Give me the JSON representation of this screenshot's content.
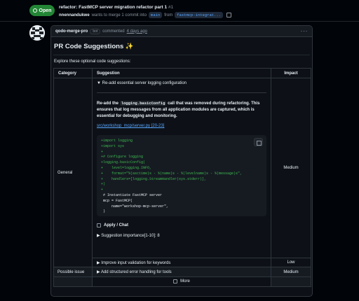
{
  "pr": {
    "status": "Open",
    "title": "refactor: FastMCP server migration refactor part 1",
    "number": "#1",
    "author": "nnennandukwe",
    "meta_middle": "wants to merge 1 commit into",
    "base_branch": "main",
    "from": "from",
    "head_branch": "fastmcp-integrat..."
  },
  "comment": {
    "author": "qodo-merge-pro",
    "bot_badge": "bot",
    "action": "commented",
    "time": "4 days ago",
    "menu": "···",
    "heading": "PR Code Suggestions ✨",
    "intro": "Explore these optional code suggestions:"
  },
  "table": {
    "headers": {
      "category": "Category",
      "suggestion": "Suggestion",
      "impact": "Impact"
    },
    "general": {
      "category": "General",
      "impact": "Medium",
      "summary": "▼ Re-add essential server logging configuration",
      "desc_pre": "Re-add the",
      "desc_code": "logging.basicConfig",
      "desc_post": "call that was removed during refactoring. This ensures that log messages from all application modules are captured, which is essential for debugging and monitoring.",
      "link": "src/workshop_mcp/server.py [20-23]",
      "code_lines": [
        {
          "text": "+import logging",
          "type": "add"
        },
        {
          "text": "+import sys",
          "type": "add"
        },
        {
          "text": "+",
          "type": "add"
        },
        {
          "text": "+# Configure logging",
          "type": "add"
        },
        {
          "text": "+logging.basicConfig(",
          "type": "add"
        },
        {
          "text": "+    level=logging.INFO,",
          "type": "add"
        },
        {
          "text": "+    format=\"%(asctime)s - %(name)s - %(levelname)s - %(message)s\",",
          "type": "add"
        },
        {
          "text": "+    handlers=[logging.StreamHandler(sys.stderr)],",
          "type": "add"
        },
        {
          "text": "+)",
          "type": "add"
        },
        {
          "text": "+",
          "type": "add"
        },
        {
          "text": " # Instantiate FastMCP server",
          "type": "ctx"
        },
        {
          "text": " mcp = FastMCP(",
          "type": "ctx"
        },
        {
          "text": "     name=\"workshop-mcp-server\",",
          "type": "ctx"
        },
        {
          "text": " )",
          "type": "ctx"
        }
      ],
      "apply_label": "Apply / Chat",
      "importance": "▶ Suggestion importance[1-10]: 8"
    },
    "general_2": {
      "summary": "▶ Improve input validation for keywords",
      "impact": "Low"
    },
    "possible_issue": {
      "category": "Possible issue",
      "summary": "▶ Add structured error handling for tools",
      "impact": "Medium"
    },
    "more_label": "More"
  },
  "colors": {
    "bg": "#010409",
    "panel": "#0d1117",
    "border": "#30363d",
    "open_green": "#238636",
    "link_blue": "#58a6ff",
    "diff_add": "#3fb950"
  },
  "icons": [
    "git-pull-request-icon",
    "copy-icon",
    "kebab-icon",
    "checkbox-icon"
  ]
}
